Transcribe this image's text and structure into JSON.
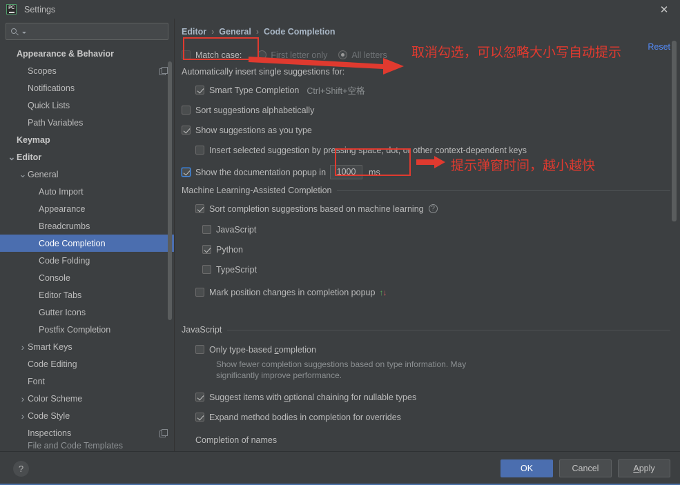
{
  "window": {
    "title": "Settings",
    "app_icon": "pycharm-icon",
    "close_icon": "close-icon"
  },
  "sidebar": {
    "search": {
      "placeholder": "",
      "value": "",
      "icon": "search-icon"
    },
    "items": [
      {
        "label": "Appearance & Behavior",
        "level": 0,
        "bold": true,
        "twisty": "",
        "copy": false
      },
      {
        "label": "Scopes",
        "level": 1,
        "bold": false,
        "twisty": "",
        "copy": true
      },
      {
        "label": "Notifications",
        "level": 1,
        "bold": false,
        "twisty": "",
        "copy": false
      },
      {
        "label": "Quick Lists",
        "level": 1,
        "bold": false,
        "twisty": "",
        "copy": false
      },
      {
        "label": "Path Variables",
        "level": 1,
        "bold": false,
        "twisty": "",
        "copy": false
      },
      {
        "label": "Keymap",
        "level": 0,
        "bold": true,
        "twisty": "",
        "copy": false
      },
      {
        "label": "Editor",
        "level": 0,
        "bold": true,
        "twisty": "v",
        "copy": false
      },
      {
        "label": "General",
        "level": 1,
        "bold": false,
        "twisty": "v",
        "copy": false
      },
      {
        "label": "Auto Import",
        "level": 2,
        "bold": false,
        "twisty": "",
        "copy": false
      },
      {
        "label": "Appearance",
        "level": 2,
        "bold": false,
        "twisty": "",
        "copy": false
      },
      {
        "label": "Breadcrumbs",
        "level": 2,
        "bold": false,
        "twisty": "",
        "copy": false
      },
      {
        "label": "Code Completion",
        "level": 2,
        "bold": false,
        "twisty": "",
        "copy": false,
        "selected": true
      },
      {
        "label": "Code Folding",
        "level": 2,
        "bold": false,
        "twisty": "",
        "copy": false
      },
      {
        "label": "Console",
        "level": 2,
        "bold": false,
        "twisty": "",
        "copy": false
      },
      {
        "label": "Editor Tabs",
        "level": 2,
        "bold": false,
        "twisty": "",
        "copy": false
      },
      {
        "label": "Gutter Icons",
        "level": 2,
        "bold": false,
        "twisty": "",
        "copy": false
      },
      {
        "label": "Postfix Completion",
        "level": 2,
        "bold": false,
        "twisty": "",
        "copy": false
      },
      {
        "label": "Smart Keys",
        "level": 1,
        "bold": false,
        "twisty": ">",
        "copy": false
      },
      {
        "label": "Code Editing",
        "level": 1,
        "bold": false,
        "twisty": "",
        "copy": false
      },
      {
        "label": "Font",
        "level": 1,
        "bold": false,
        "twisty": "",
        "copy": false
      },
      {
        "label": "Color Scheme",
        "level": 1,
        "bold": false,
        "twisty": ">",
        "copy": false
      },
      {
        "label": "Code Style",
        "level": 1,
        "bold": false,
        "twisty": ">",
        "copy": false
      },
      {
        "label": "Inspections",
        "level": 1,
        "bold": false,
        "twisty": "",
        "copy": true
      },
      {
        "label": "File and Code Templates",
        "level": 1,
        "bold": false,
        "twisty": "",
        "copy": false,
        "clipped": true
      }
    ]
  },
  "main": {
    "breadcrumb": {
      "first": "Editor",
      "second": "General",
      "third": "Code Completion",
      "separator": "›"
    },
    "reset_label": "Reset",
    "match_case": {
      "label": "Match case:",
      "checked": false,
      "options": [
        {
          "label": "First letter only",
          "selected": false,
          "disabled": true
        },
        {
          "label": "All letters",
          "selected": true,
          "disabled": true
        }
      ]
    },
    "auto_insert_label": "Automatically insert single suggestions for:",
    "smart_type": {
      "label": "Smart Type Completion",
      "shortcut": "Ctrl+Shift+空格",
      "checked": true
    },
    "sort_alpha": {
      "label": "Sort suggestions alphabetically",
      "checked": false
    },
    "show_as_type": {
      "label": "Show suggestions as you type",
      "checked": true
    },
    "insert_selected": {
      "label": "Insert selected suggestion by pressing space, dot, or other context-dependent keys",
      "checked": false
    },
    "doc_popup": {
      "label": "Show the documentation popup in",
      "checked": true,
      "value": "1000",
      "unit": "ms"
    },
    "ml_section": {
      "title": "Machine Learning-Assisted Completion",
      "sort_ml": {
        "label": "Sort completion suggestions based on machine learning",
        "checked": true,
        "help_icon": "question-mark-icon"
      },
      "languages": [
        {
          "label": "JavaScript",
          "checked": false
        },
        {
          "label": "Python",
          "checked": true
        },
        {
          "label": "TypeScript",
          "checked": false
        }
      ],
      "mark_position": {
        "label": "Mark position changes in completion popup",
        "checked": false,
        "up_arrow": "↑",
        "down_arrow": "↓"
      }
    },
    "js_section": {
      "title": "JavaScript",
      "only_type_based": {
        "label_pre": "Only type-based ",
        "label_underline": "c",
        "label_post": "ompletion",
        "checked": false,
        "hint": "Show fewer completion suggestions based on type information. May significantly improve performance."
      },
      "optional_chaining": {
        "label_pre": "Suggest items with ",
        "label_underline": "o",
        "label_post": "ptional chaining for nullable types",
        "checked": true
      },
      "expand_method": {
        "label": "Expand method bodies in completion for overrides",
        "checked": true
      }
    },
    "completion_names_title": "Completion of names"
  },
  "annotations": {
    "note1": "取消勾选，可以忽略大小写自动提示",
    "note2": "提示弹窗时间，越小越快",
    "color": "#e03a2f"
  },
  "footer": {
    "help_icon": "question-mark-icon",
    "ok_label": "OK",
    "cancel_label": "Cancel",
    "apply_label": "Apply",
    "apply_underline": "A"
  }
}
